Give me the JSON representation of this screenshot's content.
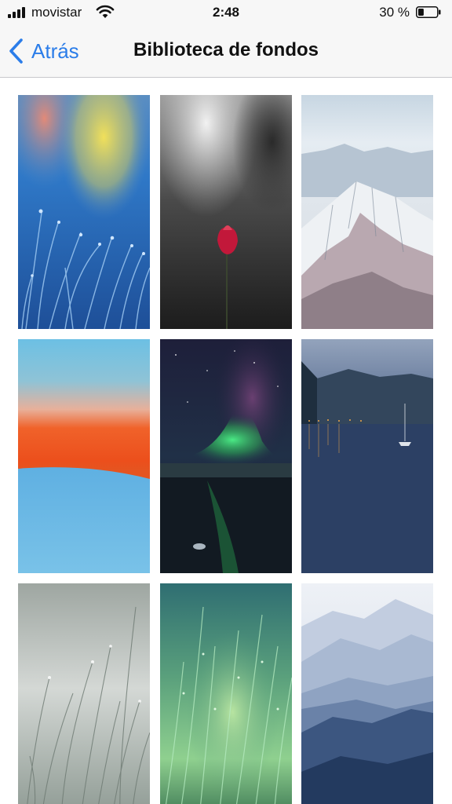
{
  "status_bar": {
    "carrier": "movistar",
    "time": "2:48",
    "battery_percent": "30 %",
    "battery_level": 0.3,
    "icons": [
      "signal-icon",
      "wifi-icon",
      "battery-icon"
    ]
  },
  "nav": {
    "back_label": "Atrás",
    "title": "Biblioteca de fondos"
  },
  "colors": {
    "accent": "#2b7de9",
    "bar_background": "#f7f7f7",
    "separator": "#c8c8cc"
  },
  "wallpapers": [
    {
      "subject": "blue-grass-dew",
      "dominant_color": "#2f6fb8"
    },
    {
      "subject": "red-tulip-dark",
      "dominant_color": "#3a3a3a"
    },
    {
      "subject": "snowy-mountains",
      "dominant_color": "#d9dde4"
    },
    {
      "subject": "orange-blue-horizon",
      "dominant_color": "#f05a1e"
    },
    {
      "subject": "northern-lights",
      "dominant_color": "#2fbf5a"
    },
    {
      "subject": "lake-night-boat",
      "dominant_color": "#2a3d5c"
    },
    {
      "subject": "grey-grass",
      "dominant_color": "#b9beba"
    },
    {
      "subject": "green-grass",
      "dominant_color": "#5a9a6a"
    },
    {
      "subject": "blue-mountain-layers",
      "dominant_color": "#3a5a85"
    }
  ]
}
